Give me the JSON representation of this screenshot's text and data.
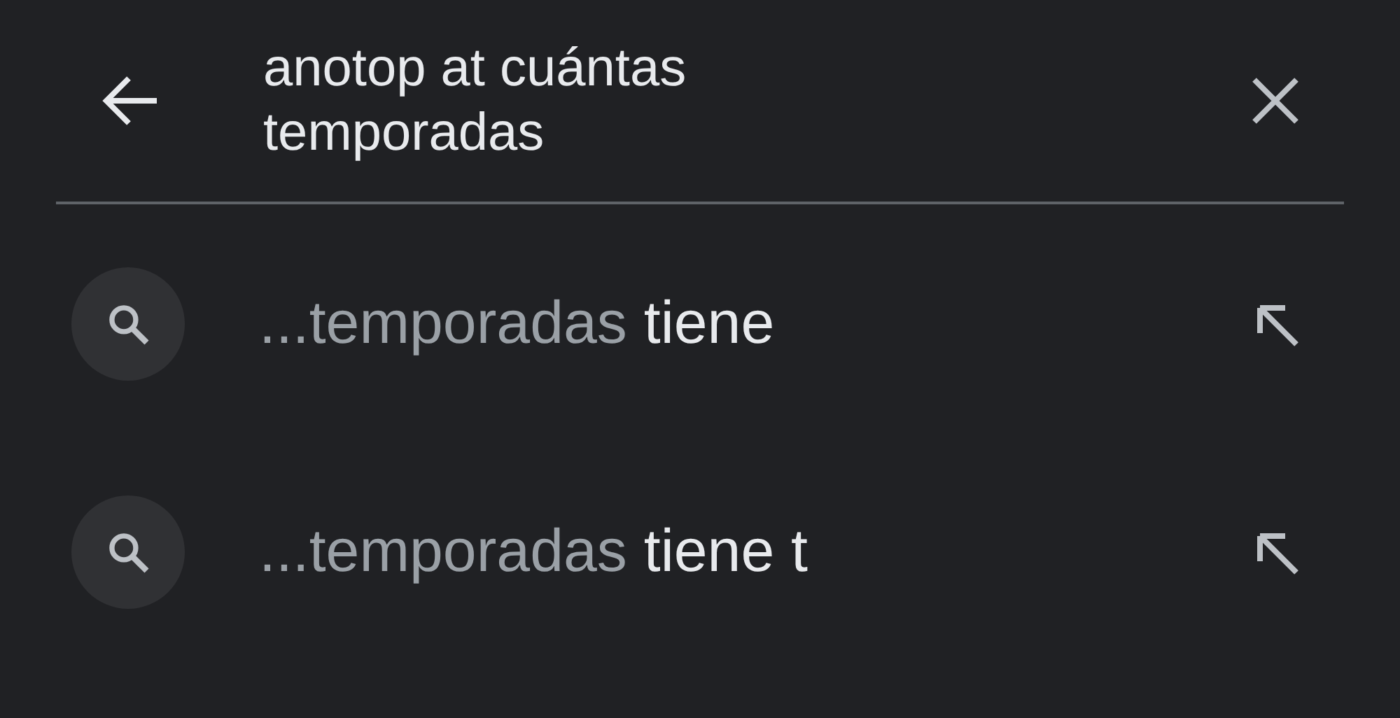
{
  "search": {
    "value": "anotop at cuántas temporadas"
  },
  "suggestions": [
    {
      "prefix": "...temporadas",
      "completion": " tiene"
    },
    {
      "prefix": "...temporadas",
      "completion": " tiene t"
    }
  ]
}
